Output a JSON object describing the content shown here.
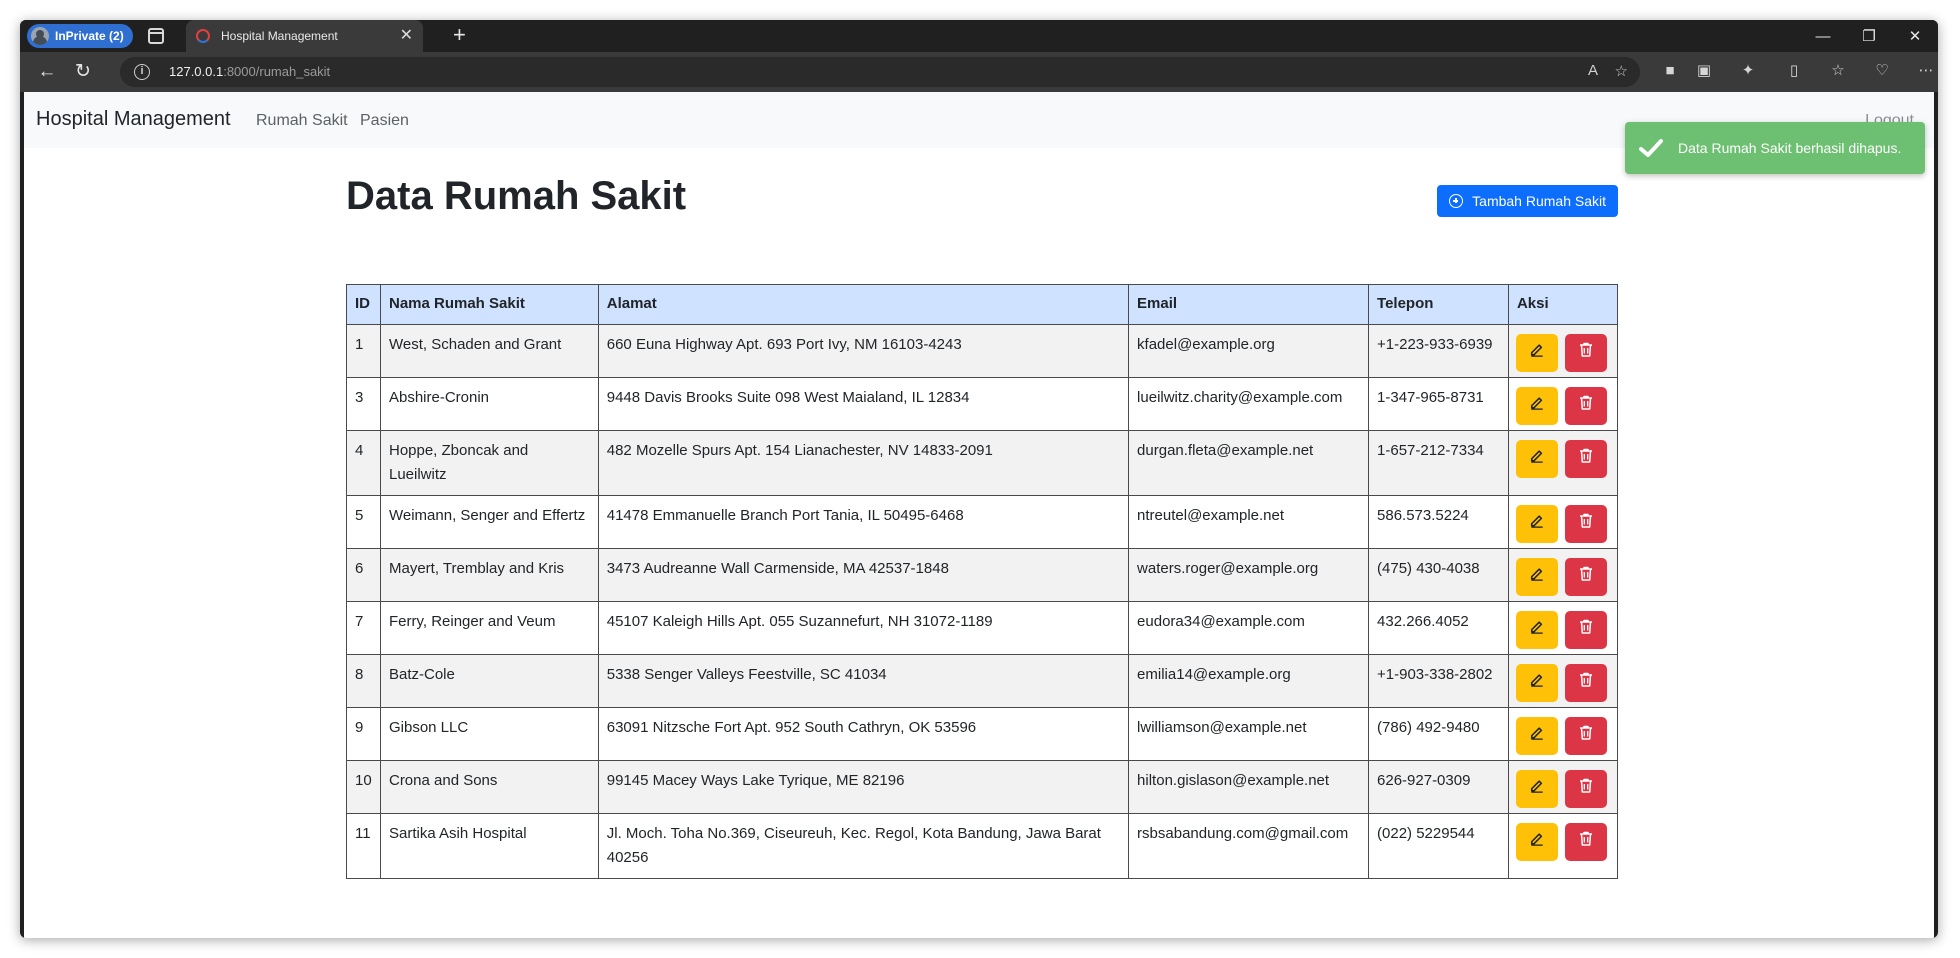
{
  "browser": {
    "profile_label": "InPrivate (2)",
    "tab_title": "Hospital Management",
    "url_host": "127.0.0.1",
    "url_path": ":8000/rumah_sakit"
  },
  "navbar": {
    "brand": "Hospital Management",
    "links": [
      "Rumah Sakit",
      "Pasien"
    ],
    "logout": "Logout"
  },
  "toast": {
    "message": "Data Rumah Sakit berhasil dihapus.",
    "color": "#6dbf72"
  },
  "page": {
    "title": "Data Rumah Sakit",
    "add_button": "Tambah Rumah Sakit"
  },
  "table": {
    "headers": [
      "ID",
      "Nama Rumah Sakit",
      "Alamat",
      "Email",
      "Telepon",
      "Aksi"
    ],
    "rows": [
      {
        "id": "1",
        "nama": "West, Schaden and Grant",
        "alamat": "660 Euna Highway Apt. 693 Port Ivy, NM 16103-4243",
        "email": "kfadel@example.org",
        "telepon": "+1-223-933-6939"
      },
      {
        "id": "3",
        "nama": "Abshire-Cronin",
        "alamat": "9448 Davis Brooks Suite 098 West Maialand, IL 12834",
        "email": "lueilwitz.charity@example.com",
        "telepon": "1-347-965-8731"
      },
      {
        "id": "4",
        "nama": "Hoppe, Zboncak and Lueilwitz",
        "alamat": "482 Mozelle Spurs Apt. 154 Lianachester, NV 14833-2091",
        "email": "durgan.fleta@example.net",
        "telepon": "1-657-212-7334"
      },
      {
        "id": "5",
        "nama": "Weimann, Senger and Effertz",
        "alamat": "41478 Emmanuelle Branch Port Tania, IL 50495-6468",
        "email": "ntreutel@example.net",
        "telepon": "586.573.5224"
      },
      {
        "id": "6",
        "nama": "Mayert, Tremblay and Kris",
        "alamat": "3473 Audreanne Wall Carmenside, MA 42537-1848",
        "email": "waters.roger@example.org",
        "telepon": "(475) 430-4038"
      },
      {
        "id": "7",
        "nama": "Ferry, Reinger and Veum",
        "alamat": "45107 Kaleigh Hills Apt. 055 Suzannefurt, NH 31072-1189",
        "email": "eudora34@example.com",
        "telepon": "432.266.4052"
      },
      {
        "id": "8",
        "nama": "Batz-Cole",
        "alamat": "5338 Senger Valleys Feestville, SC 41034",
        "email": "emilia14@example.org",
        "telepon": "+1-903-338-2802"
      },
      {
        "id": "9",
        "nama": "Gibson LLC",
        "alamat": "63091 Nitzsche Fort Apt. 952 South Cathryn, OK 53596",
        "email": "lwilliamson@example.net",
        "telepon": "(786) 492-9480"
      },
      {
        "id": "10",
        "nama": "Crona and Sons",
        "alamat": "99145 Macey Ways Lake Tyrique, ME 82196",
        "email": "hilton.gislason@example.net",
        "telepon": "626-927-0309"
      },
      {
        "id": "11",
        "nama": "Sartika Asih Hospital",
        "alamat": "Jl. Moch. Toha No.369, Ciseureuh, Kec. Regol, Kota Bandung, Jawa Barat 40256",
        "email": "rsbsabandung.com@gmail.com",
        "telepon": "(022) 5229544"
      }
    ]
  },
  "colors": {
    "primary": "#0d6efd",
    "warning": "#ffc107",
    "danger": "#dc3545",
    "header_bg": "#cfe2ff"
  }
}
